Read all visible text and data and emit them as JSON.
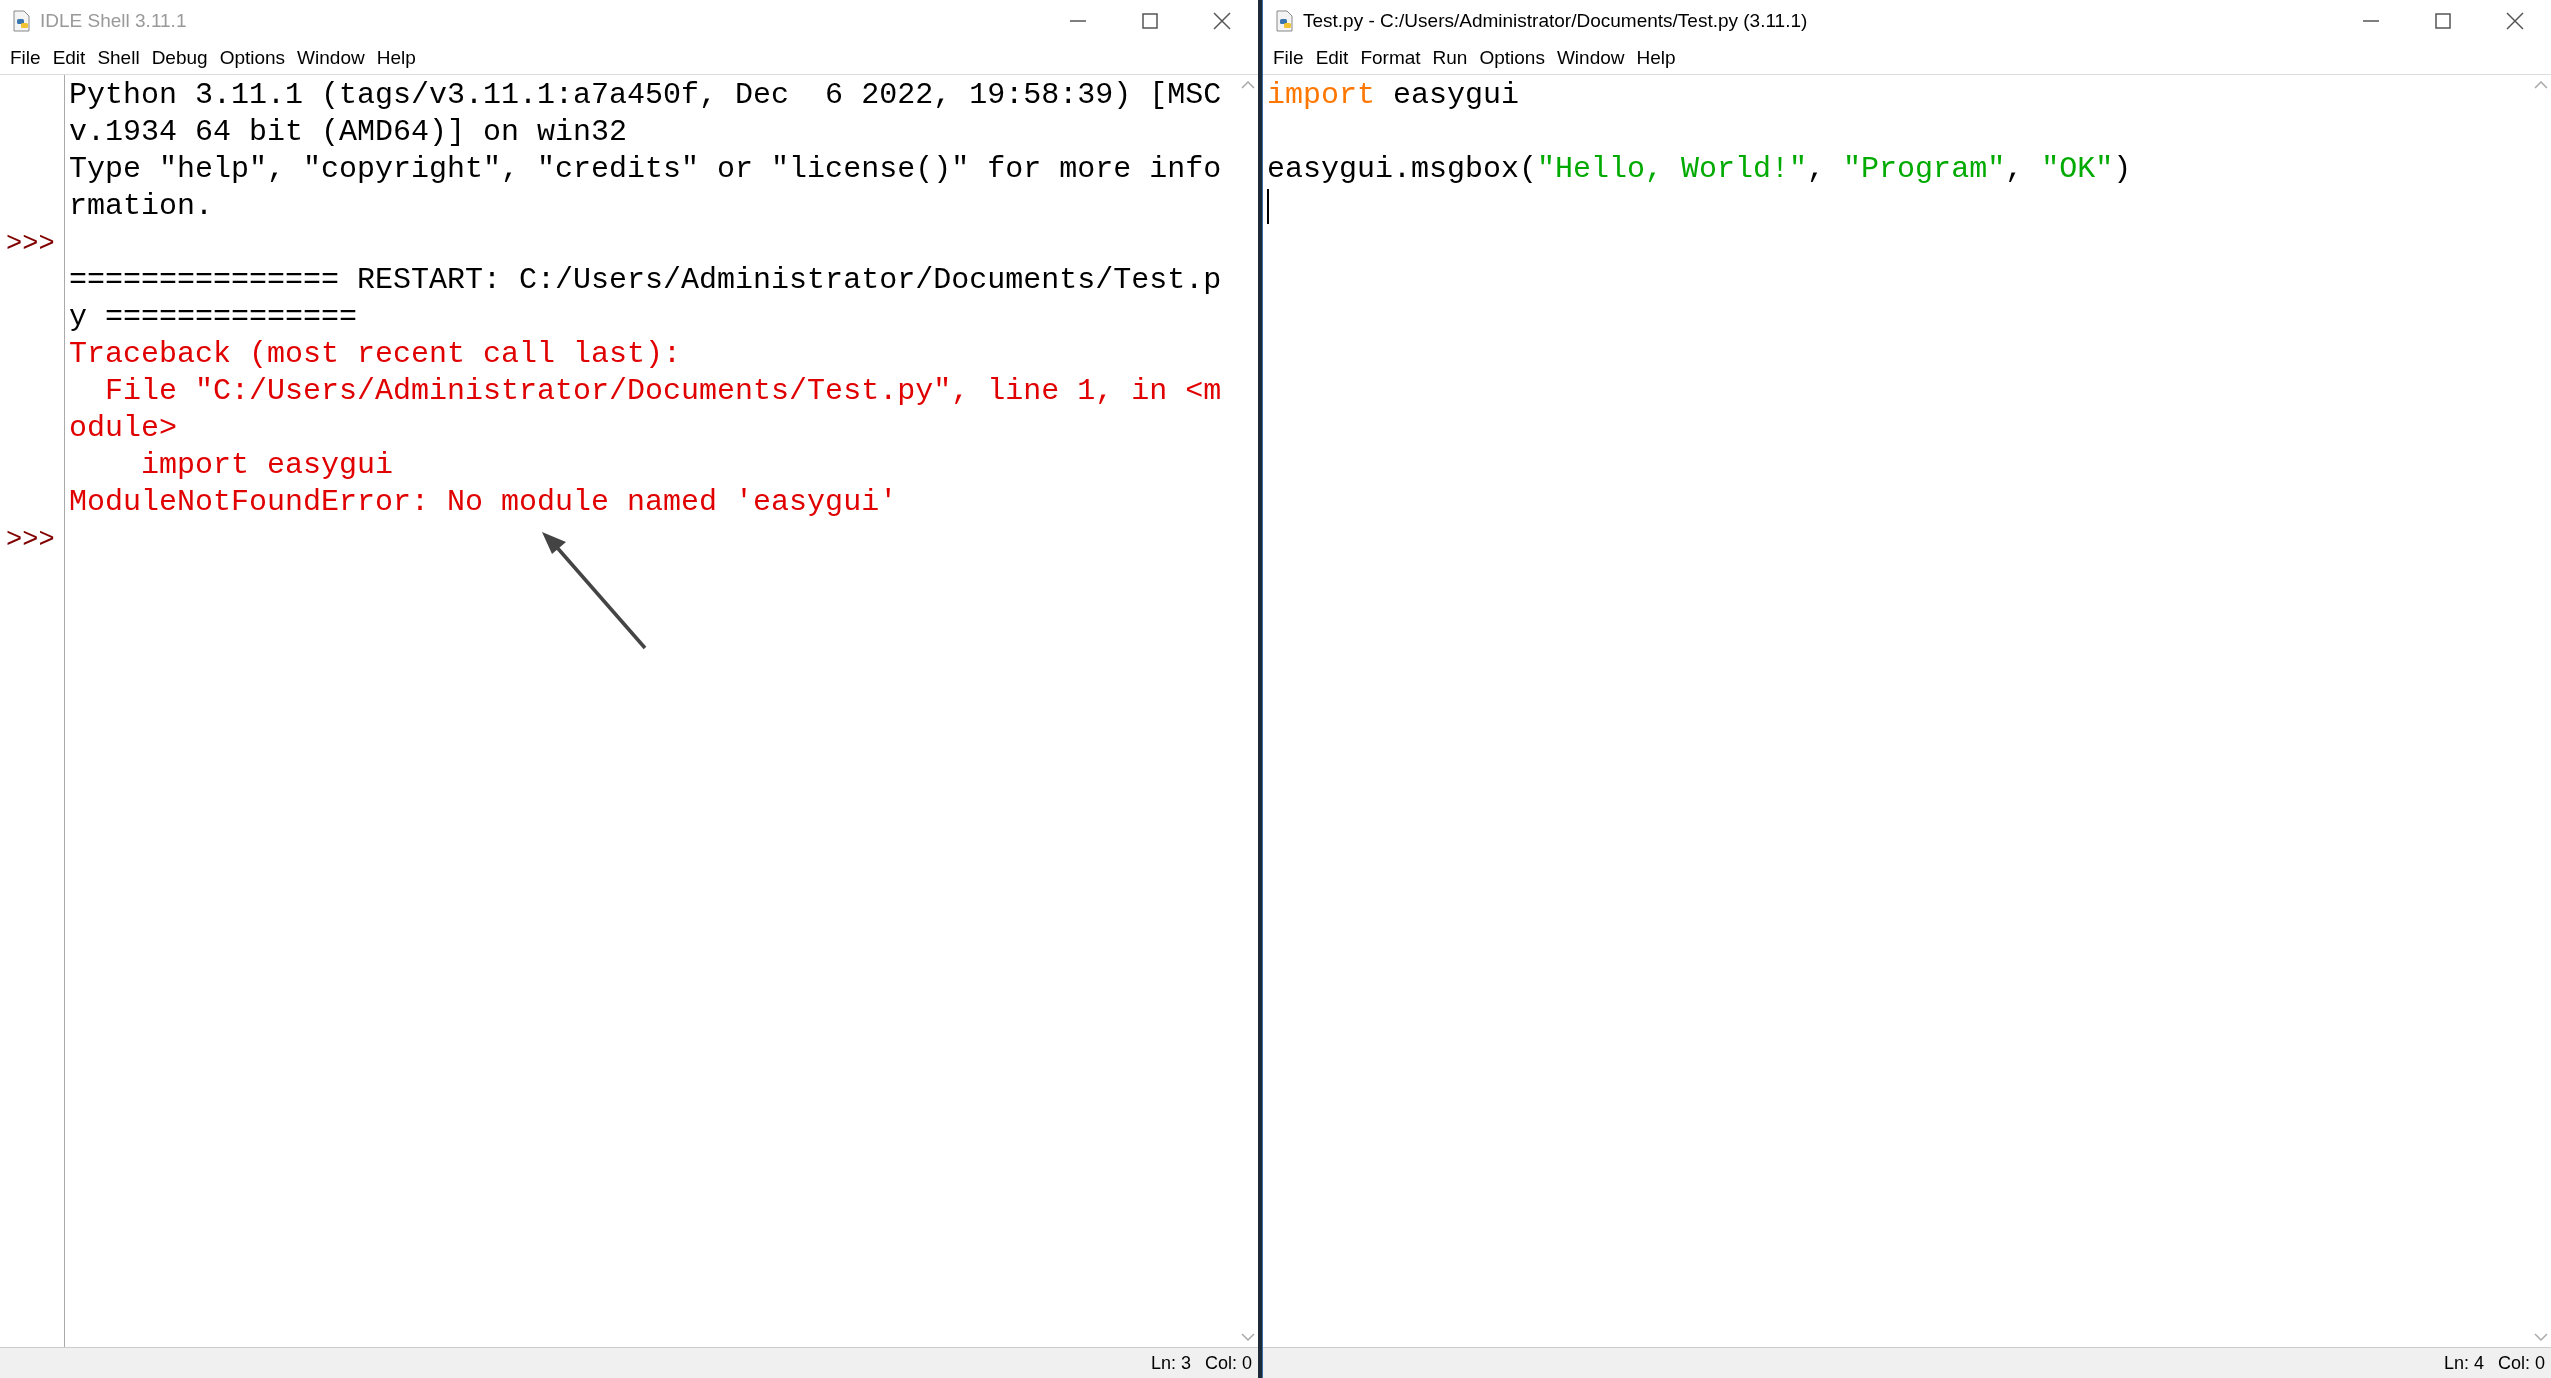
{
  "windows": [
    {
      "kind": "shell",
      "title": "IDLE Shell 3.11.1",
      "active": false,
      "menu": [
        "File",
        "Edit",
        "Shell",
        "Debug",
        "Options",
        "Window",
        "Help"
      ],
      "lines": [
        {
          "kind": "output",
          "text": "Python 3.11.1 (tags/v3.11.1:a7a450f, Dec  6 2022, 19:58:39) [MSC"
        },
        {
          "kind": "output",
          "text": "v.1934 64 bit (AMD64)] on win32"
        },
        {
          "kind": "output",
          "text": "Type \"help\", \"copyright\", \"credits\" or \"license()\" for more info"
        },
        {
          "kind": "output",
          "text": "rmation."
        },
        {
          "kind": "prompt",
          "prompt": ">>>"
        },
        {
          "kind": "output",
          "text": "=============== RESTART: C:/Users/Administrator/Documents/Test.p"
        },
        {
          "kind": "output",
          "text": "y =============="
        },
        {
          "kind": "error",
          "text": "Traceback (most recent call last):"
        },
        {
          "kind": "error",
          "text": "  File \"C:/Users/Administrator/Documents/Test.py\", line 1, in <m"
        },
        {
          "kind": "error",
          "text": "odule>"
        },
        {
          "kind": "error",
          "text": "    import easygui"
        },
        {
          "kind": "error",
          "text": "ModuleNotFoundError: No module named 'easygui'"
        },
        {
          "kind": "prompt",
          "prompt": ">>>"
        }
      ],
      "status": {
        "line": "Ln: 3",
        "column": "Col: 0"
      }
    },
    {
      "kind": "editor",
      "title": "Test.py - C:/Users/Administrator/Documents/Test.py (3.11.1)",
      "active": true,
      "menu": [
        "File",
        "Edit",
        "Format",
        "Run",
        "Options",
        "Window",
        "Help"
      ],
      "lines": [
        {
          "kind": "code",
          "tokens": [
            {
              "kind": "keyword",
              "text": "import"
            },
            {
              "kind": "plain",
              "text": " easygui"
            }
          ]
        },
        {
          "kind": "blank"
        },
        {
          "kind": "code",
          "tokens": [
            {
              "kind": "plain",
              "text": "easygui.msgbox("
            },
            {
              "kind": "string",
              "text": "\"Hello, World!\""
            },
            {
              "kind": "plain",
              "text": ", "
            },
            {
              "kind": "string",
              "text": "\"Program\""
            },
            {
              "kind": "plain",
              "text": ", "
            },
            {
              "kind": "string",
              "text": "\"OK\""
            },
            {
              "kind": "plain",
              "text": ")"
            }
          ]
        },
        {
          "kind": "cursor"
        }
      ],
      "status": {
        "line": "Ln: 4",
        "column": "Col: 0"
      }
    }
  ]
}
